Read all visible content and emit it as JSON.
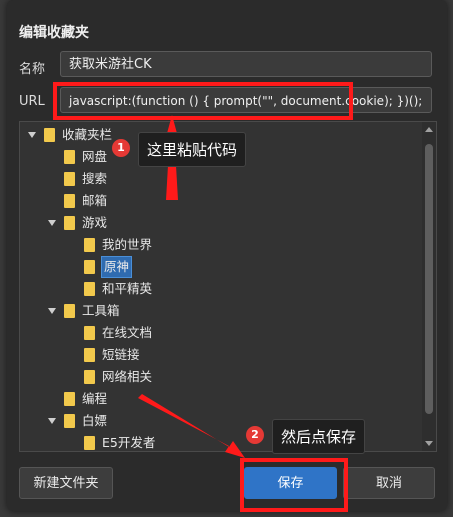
{
  "dialog": {
    "title": "编辑收藏夹",
    "name_label": "名称",
    "name_value": "获取米游社CK",
    "url_label": "URL",
    "url_value": "javascript:(function () { prompt(\"\", document.cookie); })();"
  },
  "tree": {
    "items": [
      {
        "label": "收藏夹栏",
        "expanded": true
      },
      {
        "label": "网盘"
      },
      {
        "label": "搜索"
      },
      {
        "label": "邮箱"
      },
      {
        "label": "游戏",
        "expanded": true
      },
      {
        "label": "我的世界"
      },
      {
        "label": "原神",
        "selected": true
      },
      {
        "label": "和平精英"
      },
      {
        "label": "工具箱",
        "expanded": true
      },
      {
        "label": "在线文档"
      },
      {
        "label": "短链接"
      },
      {
        "label": "网络相关"
      },
      {
        "label": "编程"
      },
      {
        "label": "白嫖",
        "expanded": true
      },
      {
        "label": "E5开发者"
      }
    ]
  },
  "buttons": {
    "new_folder": "新建文件夹",
    "save": "保存",
    "cancel": "取消"
  },
  "annotations": {
    "step1_badge": "1",
    "step1_text": "这里粘贴代码",
    "step2_badge": "2",
    "step2_text": "然后点保存",
    "color": "#ff1a1a"
  },
  "colors": {
    "accent": "#2f74c7",
    "folder": "#f2c94c"
  }
}
